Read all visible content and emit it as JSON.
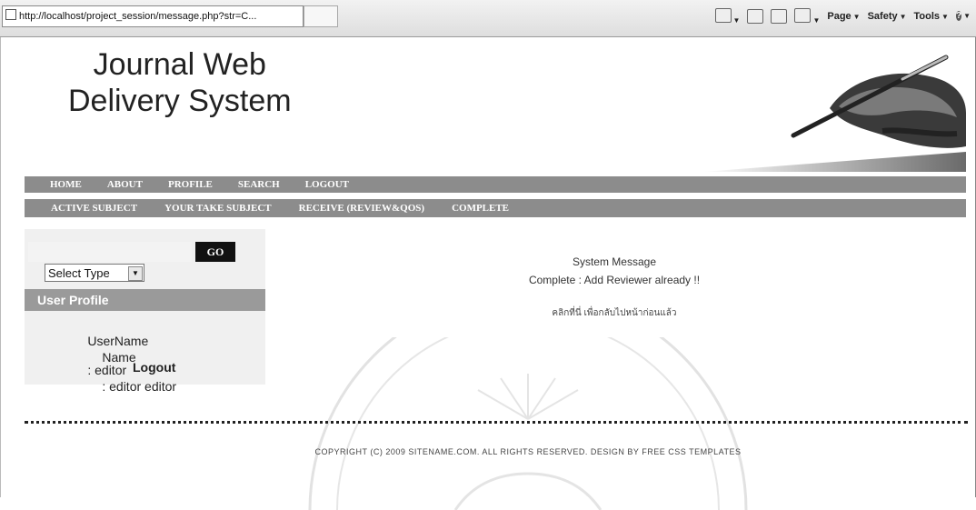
{
  "browser": {
    "url": "http://localhost/project_session/message.php?str=C...",
    "commands": {
      "page": "Page",
      "safety": "Safety",
      "tools": "Tools"
    }
  },
  "header": {
    "title_line1": "Journal Web",
    "title_line2": "Delivery System"
  },
  "nav_main": [
    "HOME",
    "ABOUT",
    "PROFILE",
    "SEARCH",
    "LOGOUT"
  ],
  "nav_sub": [
    "ACTIVE SUBJECT",
    "YOUR TAKE SUBJECT",
    "RECEIVE (REVIEW&QOS)",
    "COMPLETE"
  ],
  "sidebar": {
    "search_value": "",
    "go_label": "GO",
    "select_value": "Select Type",
    "profile_heading": "User Profile",
    "username_label": "UserName",
    "username_value": ": editor",
    "name_label": "Name",
    "name_value": ": editor editor",
    "logout_label": "Logout"
  },
  "main": {
    "title": "System Message",
    "message": "Complete : Add Reviewer already !!",
    "back_link": "คลิกที่นี่ เพื่อกลับไปหน้าก่อนแล้ว"
  },
  "footer": {
    "copyright": "COPYRIGHT (C) 2009 SITENAME.COM. ALL RIGHTS RESERVED. DESIGN BY FREE CSS TEMPLATES"
  }
}
